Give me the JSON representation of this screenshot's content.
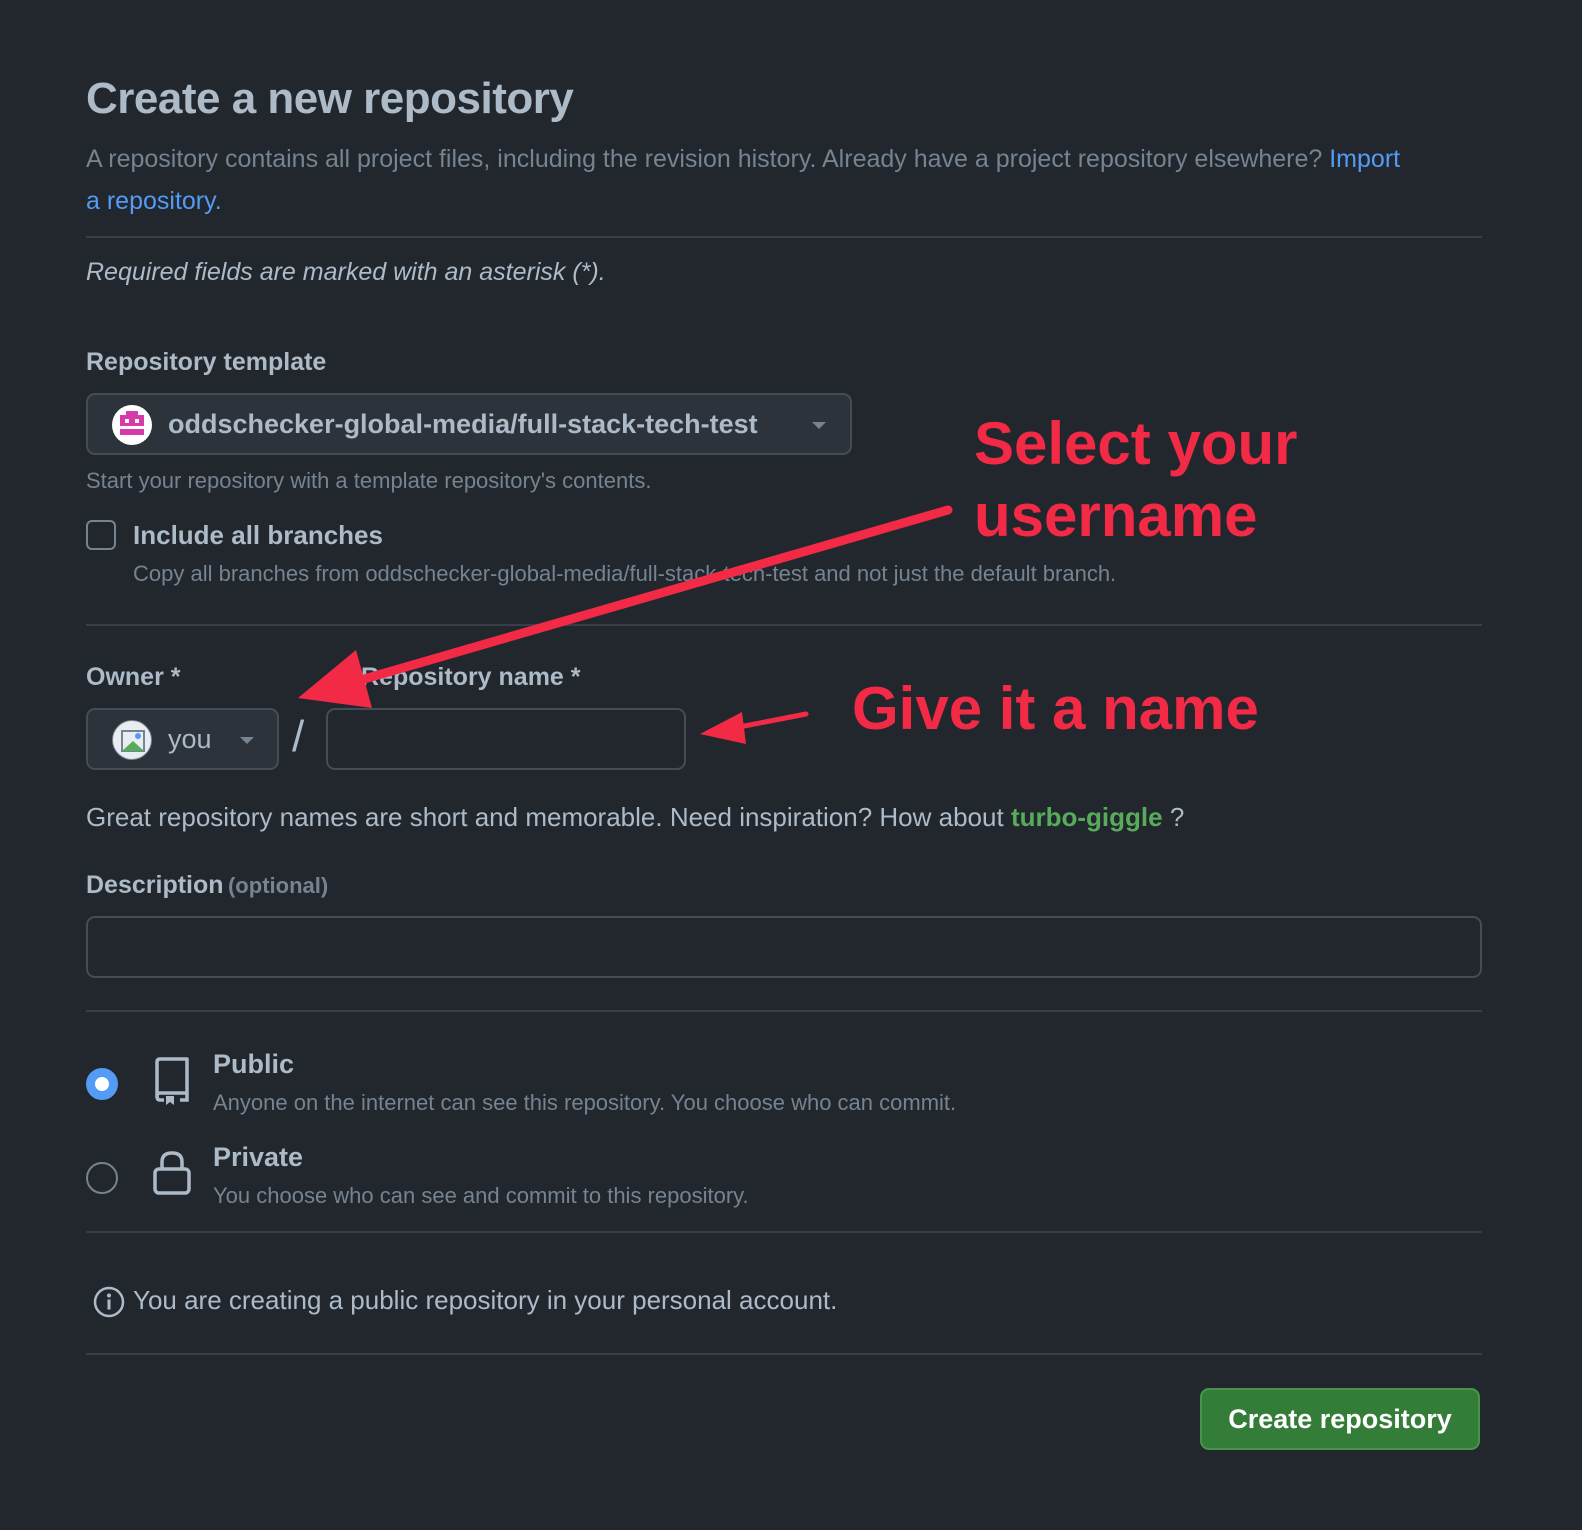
{
  "header": {
    "title": "Create a new repository",
    "intro": "A repository contains all project files, including the revision history. Already have a project repository elsewhere?",
    "import_link": "Import a repository."
  },
  "required_note": "Required fields are marked with an asterisk (*).",
  "template": {
    "label": "Repository template",
    "selected": "oddschecker-global-media/full-stack-tech-test",
    "help": "Start your repository with a template repository's contents.",
    "include_branches_label": "Include all branches",
    "include_branches_checked": false,
    "include_branches_help": "Copy all branches from oddschecker-global-media/full-stack-tech-test and not just the default branch."
  },
  "owner": {
    "label": "Owner *",
    "value": "you"
  },
  "separator": "/",
  "repo_name": {
    "label": "Repository name *",
    "value": ""
  },
  "name_hint": {
    "text": "Great repository names are short and memorable. Need inspiration? How about",
    "suggestion": "turbo-giggle",
    "suffix": "?"
  },
  "description": {
    "label": "Description",
    "optional": "(optional)",
    "value": ""
  },
  "visibility": {
    "selected": "Public",
    "options": [
      {
        "label": "Public",
        "desc": "Anyone on the internet can see this repository. You choose who can commit.",
        "icon": "repo-icon",
        "selected": true
      },
      {
        "label": "Private",
        "desc": "You choose who can see and commit to this repository.",
        "icon": "lock-icon",
        "selected": false
      }
    ]
  },
  "info_note": "You are creating a public repository in your personal account.",
  "create_button": "Create repository",
  "annotations": {
    "select_username": [
      "Select your",
      "username"
    ],
    "give_name": "Give it a name",
    "color": "#f22a45"
  },
  "colors": {
    "background": "#22272e",
    "link": "#539bf5",
    "suggestion": "#57ab5a",
    "button": "#347d39"
  }
}
